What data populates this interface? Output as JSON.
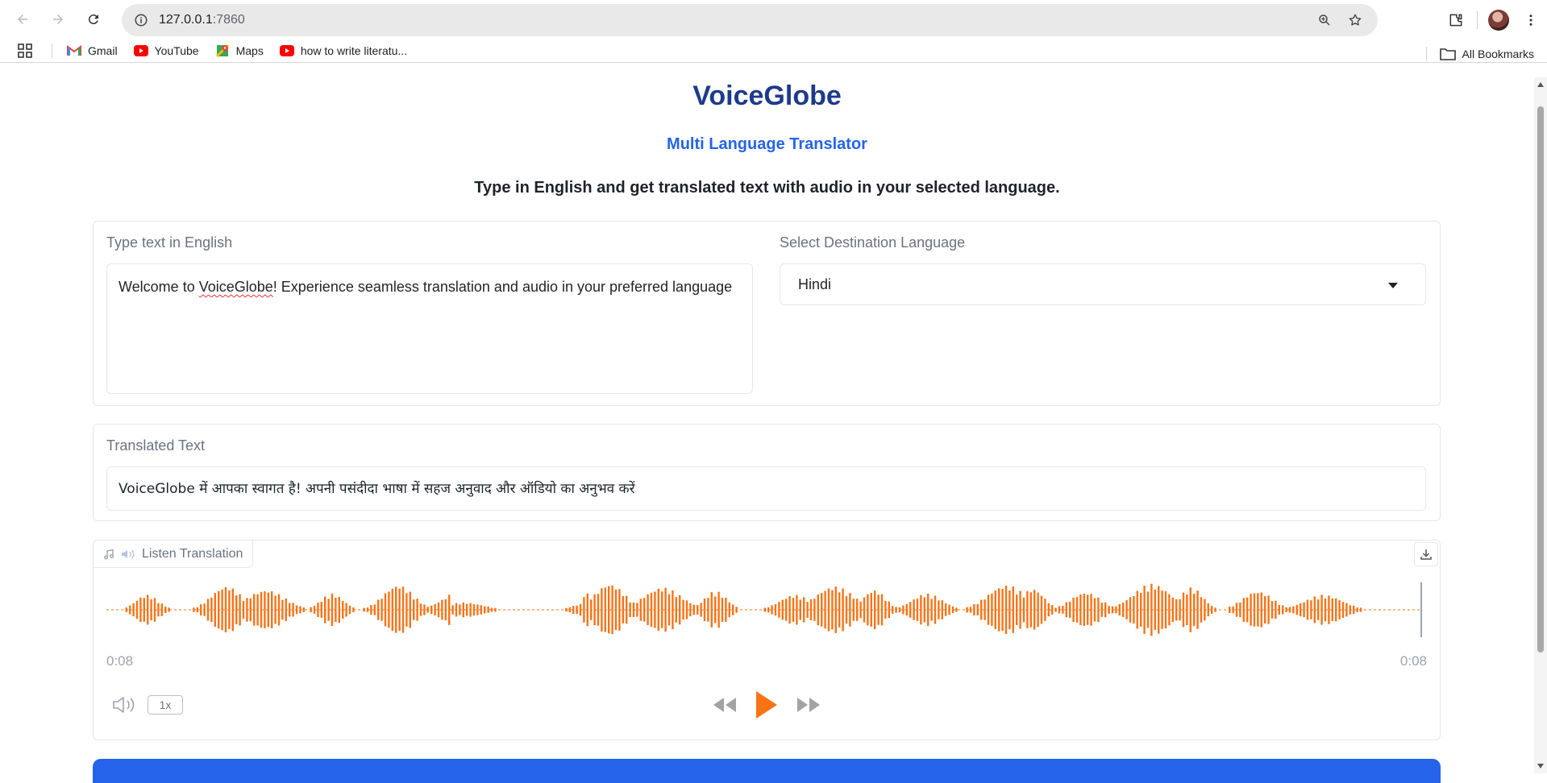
{
  "browser": {
    "url_host": "127.0.0.1",
    "url_port": ":7860",
    "bookmarks": [
      {
        "label": "Gmail",
        "icon": "gmail-icon"
      },
      {
        "label": "YouTube",
        "icon": "youtube-icon"
      },
      {
        "label": "Maps",
        "icon": "maps-icon"
      },
      {
        "label": "how to write literatu...",
        "icon": "youtube-icon"
      }
    ],
    "all_bookmarks": "All Bookmarks"
  },
  "app": {
    "title": "VoiceGlobe",
    "subtitle": "Multi Language Translator",
    "description": "Type in English and get translated text with audio in your selected language."
  },
  "input": {
    "label": "Type text in English",
    "text_pre": "Welcome to ",
    "text_misspelled": "VoiceGlobe",
    "text_post": "! Experience seamless translation and audio in your preferred language"
  },
  "language": {
    "label": "Select Destination Language",
    "selected": "Hindi"
  },
  "translated": {
    "label": "Translated Text",
    "value": "VoiceGlobe में आपका स्वागत है! अपनी पसंदीदा भाषा में सहज अनुवाद और ऑडियो का अनुभव करें"
  },
  "audio": {
    "label": "Listen Translation",
    "current_time": "0:08",
    "duration": "0:08",
    "speed": "1x",
    "progress": 1.0,
    "waveform_color": "#f97316"
  },
  "colors": {
    "title": "#1e3a8a",
    "accent": "#2563eb",
    "waveform": "#f97316"
  }
}
